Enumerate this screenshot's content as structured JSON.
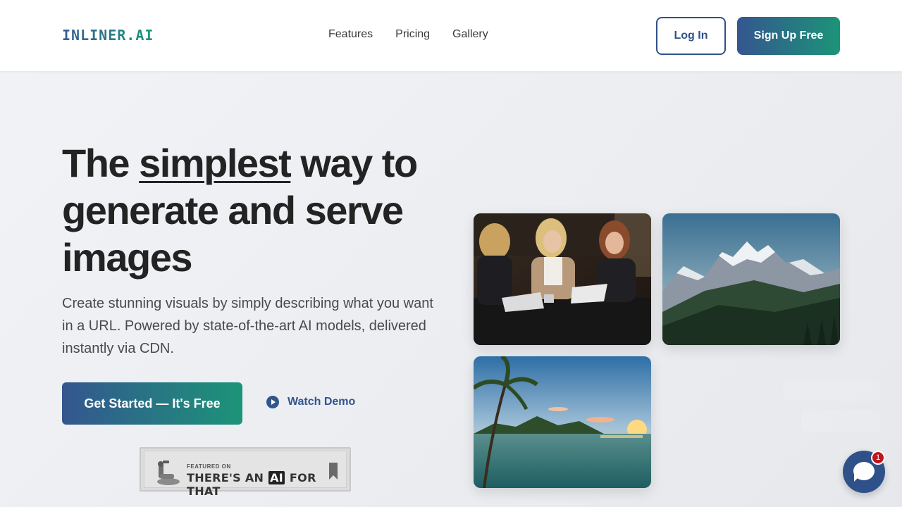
{
  "header": {
    "logo": "INLINER.AI",
    "nav": [
      "Features",
      "Pricing",
      "Gallery"
    ],
    "login_label": "Log In",
    "signup_label": "Sign Up Free"
  },
  "hero": {
    "headline_before": "The ",
    "headline_emphasis": "simplest",
    "headline_after": " way to generate and serve images",
    "subtext": "Create stunning visuals by simply describing what you want in a URL. Powered by state-of-the-art AI models, delivered instantly via CDN.",
    "cta_label": "Get Started — It's Free",
    "demo_label": "Watch Demo"
  },
  "badge": {
    "small": "FEATURED ON",
    "big_before": "THERE'S AN ",
    "big_ai": "AI",
    "big_after": " FOR THAT"
  },
  "gallery": {
    "images": [
      "business-meeting-photo",
      "mountain-range-photo",
      "tropical-sunset-photo"
    ]
  },
  "chat": {
    "unread_count": "1"
  },
  "colors": {
    "brand_blue": "#2f5189",
    "brand_green": "#1c9478",
    "text_dark": "#232323",
    "badge_red": "#c0151c"
  }
}
